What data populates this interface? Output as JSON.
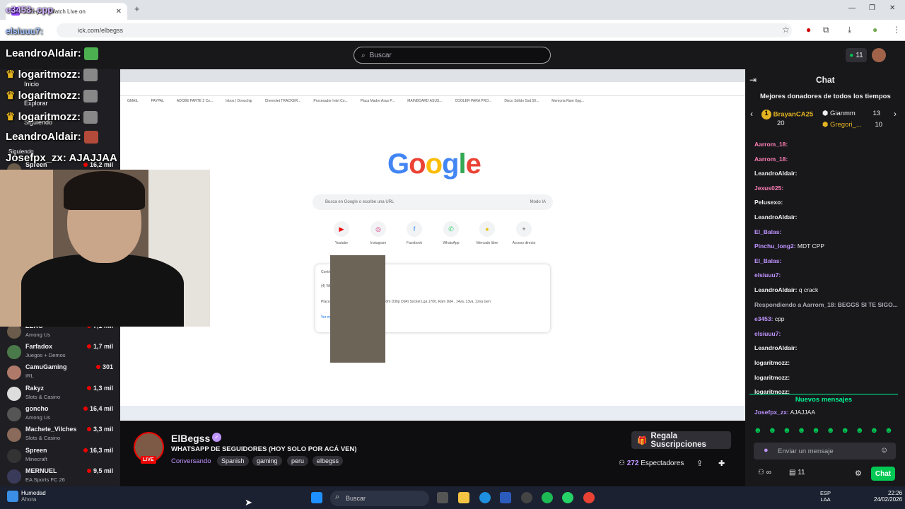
{
  "browser": {
    "tab_title": "ElBegss - Watch Live on",
    "url": "ick.com/elbegss"
  },
  "topnav": {
    "search_placeholder": "Buscar",
    "notif_count": "11"
  },
  "sidebar": {
    "nav": [
      "Inicio",
      "Explorar",
      "Siguiendo"
    ],
    "section": "Siguiendo",
    "channels": [
      {
        "name": "Spreen",
        "game": "",
        "viewers": "16,2 mil"
      },
      {
        "name": "ZEKO",
        "game": "Among Us",
        "viewers": "7,1 mil"
      },
      {
        "name": "Farfadox",
        "game": "Juegos + Demos",
        "viewers": "1,7 mil"
      },
      {
        "name": "CamuGaming",
        "game": "IRL",
        "viewers": "301"
      },
      {
        "name": "Rakyz",
        "game": "Slots & Casino",
        "viewers": "1,3 mil"
      },
      {
        "name": "goncho",
        "game": "Among Us",
        "viewers": "16,4 mil"
      },
      {
        "name": "Machete_Vilches",
        "game": "Slots & Casino",
        "viewers": "3,3 mil"
      },
      {
        "name": "Spreen",
        "game": "Minecraft",
        "viewers": "16,3 mil"
      },
      {
        "name": "MERNUEL",
        "game": "EA Sports FC 26",
        "viewers": "9,5 mil"
      }
    ]
  },
  "overlay_chat": [
    {
      "user": "e3453",
      "text": ": cpp"
    },
    {
      "user": "elsiuuu7",
      "text": ":"
    },
    {
      "user": "LeandroAldair",
      "text": ":"
    },
    {
      "user": "logaritmozz",
      "text": ":"
    },
    {
      "user": "logaritmozz",
      "text": ":"
    },
    {
      "user": "logaritmozz",
      "text": ":"
    },
    {
      "user": "LeandroAldair",
      "text": ":"
    },
    {
      "user": "Josefpx_zx",
      "text": ": AJAJJAA"
    }
  ],
  "inner_screen": {
    "google_logo": "Google",
    "search_placeholder": "Busca en Google o escribe una URL",
    "ai_mode": "Modo IA",
    "shortcuts": [
      "Youtube",
      "Instagram",
      "Facebook",
      "WhatsApp",
      "Mercado libre",
      "Acceso directo"
    ],
    "tabs_card_title": "Continúa con estas pestañas",
    "tabs_card_items": [
      "(4) WhatsApp",
      "Placa Madre Gigabyte B760m D3hp (b760m D3hp Dd4) Socket Lga 1700, Ram Dd4 , 14va, 13va, 12va Gen"
    ],
    "see_more": "Ver más",
    "bookmarks": [
      "GMAIL",
      "PAYPAL",
      "ADOBE PARTE 2 Co...",
      "Inbox | Donochip",
      "Chevrolet TRACKER...",
      "Procesador Intel Co...",
      "Placa Madre Asus P...",
      "MAINBOARD ASUS...",
      "COOLER PARA PRO...",
      "Disco Sólido Ssd 50...",
      "Memoria Ram Xpg..."
    ]
  },
  "stream": {
    "streamer": "ElBegss",
    "live_badge": "LIVE",
    "title": "WHATSAPP DE SEGUIDORES (HOY SOLO POR ACÁ VEN)",
    "category": "Conversando",
    "tags": [
      "Spanish",
      "gaming",
      "peru",
      "elbegss"
    ],
    "gift_button": "Regala Suscripciones",
    "viewers_count": "272",
    "viewers_label": "Espectadores"
  },
  "chat": {
    "title": "Chat",
    "donors_title": "Mejores donadores de todos los tiempos",
    "donors": [
      {
        "name": "BrayanCA25",
        "amount": "20"
      },
      {
        "name": "Gianmm",
        "amount": "13"
      },
      {
        "name": "Gregori_...",
        "amount": "10"
      }
    ],
    "messages": [
      {
        "user": "Aarrom_18:",
        "text": "",
        "color": "#ff7eb6"
      },
      {
        "user": "Aarrom_18:",
        "text": "",
        "color": "#ff7eb6"
      },
      {
        "user": "LeandroAldair:",
        "text": "",
        "color": "#efeff1"
      },
      {
        "user": "Jexus025:",
        "text": "",
        "color": "#ff7eb6"
      },
      {
        "user": "Pelusexo:",
        "text": "",
        "color": "#efeff1"
      },
      {
        "user": "LeandroAldair:",
        "text": "",
        "color": "#efeff1"
      },
      {
        "user": "El_Balas:",
        "text": "",
        "color": "#bf94ff"
      },
      {
        "user": "Pinchu_long2:",
        "text": " MDT CPP",
        "color": "#bf94ff"
      },
      {
        "user": "El_Balas:",
        "text": "",
        "color": "#bf94ff"
      },
      {
        "user": "elsiuuu7:",
        "text": "",
        "color": "#bf94ff"
      },
      {
        "user": "LeandroAldair:",
        "text": " q crack",
        "color": "#efeff1"
      },
      {
        "user": "Respondiendo a Aarrom_18: BEGGS SI TE SIGO...",
        "text": "",
        "color": "#adadb8"
      },
      {
        "user": "e3453:",
        "text": " cpp",
        "color": "#bf94ff"
      },
      {
        "user": "elsiuuu7:",
        "text": "",
        "color": "#bf94ff"
      },
      {
        "user": "LeandroAldair:",
        "text": "",
        "color": "#efeff1"
      },
      {
        "user": "logaritmozz:",
        "text": "",
        "color": "#efeff1"
      },
      {
        "user": "logaritmozz:",
        "text": "",
        "color": "#efeff1"
      },
      {
        "user": "logaritmozz:",
        "text": "",
        "color": "#efeff1"
      }
    ],
    "new_messages": "Nuevos mensajes",
    "last_message": {
      "user": "Josefpx_zx:",
      "text": " AJAJJAA"
    },
    "input_placeholder": "Enviar un mensaje",
    "points": "11",
    "send_button": "Chat"
  },
  "taskbar": {
    "weather_title": "Humedad",
    "weather_sub": "Ahora",
    "search": "Buscar",
    "lang1": "ESP",
    "lang2": "LAA",
    "time": "22:26",
    "date": "24/02/2026"
  }
}
